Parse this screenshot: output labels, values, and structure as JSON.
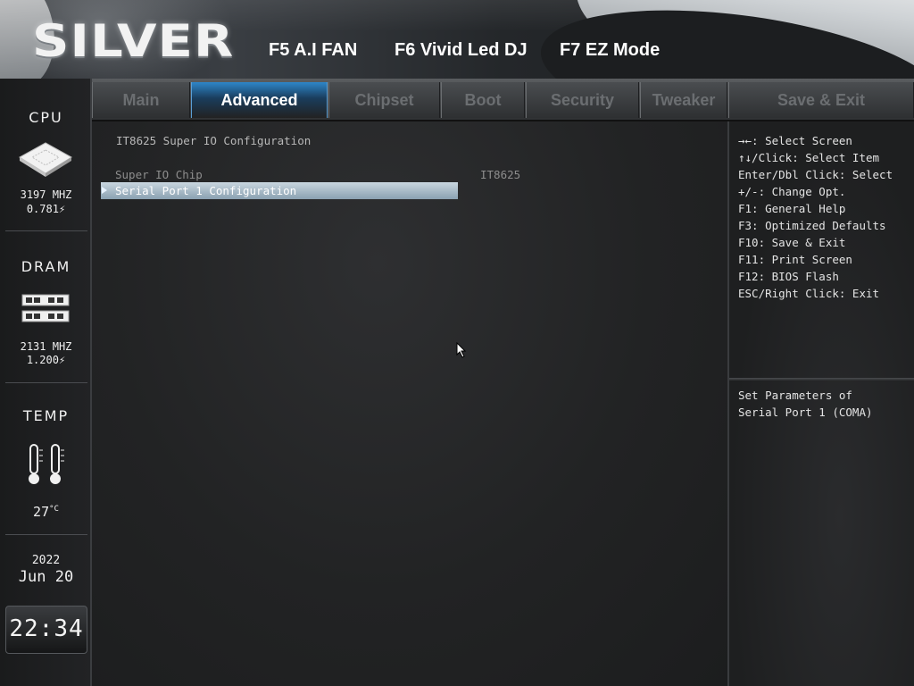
{
  "header": {
    "logo": "SILVER",
    "hotkeys": [
      "F5 A.I FAN",
      "F6 Vivid Led DJ",
      "F7 EZ Mode"
    ]
  },
  "sidebar": {
    "cpu": {
      "label": "CPU",
      "freq": "3197 MHZ",
      "volt": "0.781"
    },
    "dram": {
      "label": "DRAM",
      "freq": "2131 MHZ",
      "volt": "1.200"
    },
    "temp": {
      "label": "TEMP",
      "value": "27",
      "unit": "°C"
    },
    "date": {
      "year": "2022",
      "month_day": "Jun 20"
    },
    "clock": "22:34"
  },
  "tabs": [
    "Main",
    "Advanced",
    "Chipset",
    "Boot",
    "Security",
    "Tweaker",
    "Save & Exit"
  ],
  "active_tab": "Advanced",
  "main": {
    "title": "IT8625 Super IO Configuration",
    "items": [
      {
        "label": "Super IO Chip",
        "value": "IT8625"
      },
      {
        "label": "Serial Port 1 Configuration",
        "selected": true
      }
    ]
  },
  "help": {
    "keys": [
      "→←: Select Screen",
      "↑↓/Click: Select Item",
      "Enter/Dbl Click: Select",
      "+/-: Change Opt.",
      "F1: General Help",
      "F3: Optimized Defaults",
      "F10: Save & Exit",
      "F11: Print Screen",
      "F12: BIOS Flash",
      "ESC/Right Click: Exit"
    ],
    "description": [
      "Set Parameters of",
      "Serial Port 1 (COMA)"
    ]
  },
  "colors": {
    "accent_blue": "#2e86c9",
    "selection": "#8aa1b1",
    "background": "#1e1e1f"
  }
}
